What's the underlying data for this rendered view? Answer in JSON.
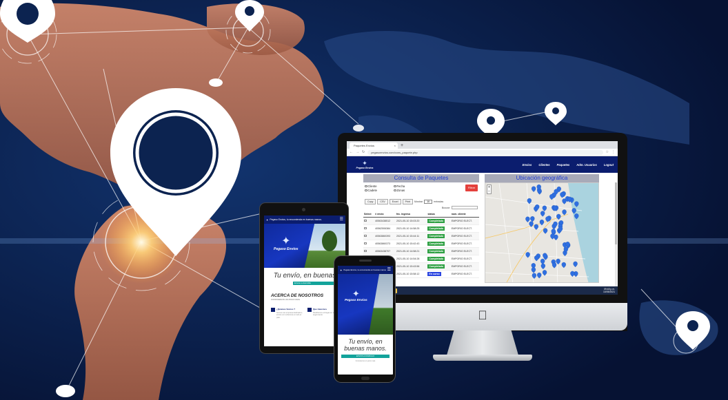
{
  "desktop": {
    "browser": {
      "tab_title": "Paquetes Envios",
      "tab_close": "×",
      "new_tab": "+",
      "url": "pegasoenvios.com/cons_paquete.php"
    },
    "site": {
      "logo_icon": "pegasus-wing-icon",
      "logo_text": "Pegaso Envios",
      "nav": [
        "Envios",
        "Clientes",
        "Paquetes",
        "Adm. Usuarios",
        "Logout"
      ]
    },
    "consulta": {
      "title": "Consulta de Paquetes",
      "filters": {
        "cliente": "Cliente",
        "cadete": "Cadete",
        "fecha": "Fecha",
        "zonas": "Zonas",
        "filtrar": "Filtrar"
      },
      "toolbar": {
        "buttons": [
          "Copy",
          "CSV",
          "Excel",
          "Print"
        ],
        "mostrar": "Mostrar",
        "page_size": "10",
        "entradas": "entradas",
        "buscar": "Buscar:"
      },
      "columns": [
        "Select",
        "# envio",
        "fec. ingreso",
        "status",
        "nom. cliente"
      ],
      "rows": [
        {
          "id": "40563438512",
          "fecha": "2021-05-10 15:03:20",
          "status": "Completado",
          "cliente": "EMPORIO ELECT."
        },
        {
          "id": "40562506384",
          "fecha": "2021-05-10 14:58:25",
          "status": "Completado",
          "cliente": "EMPORIO ELECT."
        },
        {
          "id": "40563860393",
          "fecha": "2021-05-10 15:44:11",
          "status": "Completado",
          "cliente": "EMPORIO ELECT."
        },
        {
          "id": "40563860373",
          "fecha": "2021-05-10 15:42:43",
          "status": "Completado",
          "cliente": "EMPORIO ELECT."
        },
        {
          "id": "40563438707",
          "fecha": "2021-05-10 14:58:21",
          "status": "Completado",
          "cliente": "EMPORIO ELECT."
        },
        {
          "id": "40563438546",
          "fecha": "2021-05-10 14:54:28",
          "status": "Completado",
          "cliente": "EMPORIO ELECT."
        },
        {
          "id": "40563438549",
          "fecha": "2021-05-10 15:43:56",
          "status": "Completado",
          "cliente": "EMPORIO ELECT."
        },
        {
          "id": "40563438542",
          "fecha": "2021-05-10 15:58:12",
          "status": "En curso",
          "cliente": "EMPORIO ELECT."
        }
      ]
    },
    "ubicacion": {
      "title": "Ubicación geográfica",
      "zoom_in": "+",
      "zoom_out": "−"
    },
    "taskbar": {
      "app_label": "Paquetes Envios",
      "time": "09:48 p.m.",
      "date": "10/05/2021"
    }
  },
  "tablet": {
    "nav_label": "Pegaso Envios, tu encomienda en buenas manos.",
    "logo_text": "Pegaso Envios",
    "tagline": "Tu envío, en buenas",
    "cta": "Envios a domicilio",
    "about_title": "ACERCA DE NOSOTROS",
    "about_sub": "CONOCENOS UN POCO MAS",
    "features": [
      {
        "title": "¿Quienes Somos ?",
        "text": "Somos una empresa dedicada a envios con cobertura en todo el pais."
      },
      {
        "title": "Que Hacemos",
        "text": "Realizamos entregas en el dia con seguimiento."
      }
    ]
  },
  "phone": {
    "nav_label": "Pegaso Envios, tu encomienda en buenas manos.",
    "logo_text": "Pegaso Envios",
    "tagline": "Tu envío, en buenas manos.",
    "cta": "ENVIOS A DOMICILIO",
    "footer": "Conocenos un poco mas"
  },
  "colors": {
    "navy": "#0b1d6e",
    "status_done": "#2ea043",
    "status_progress": "#2b45e0",
    "filter_button": "#e4403c",
    "teal": "#13a39b"
  }
}
